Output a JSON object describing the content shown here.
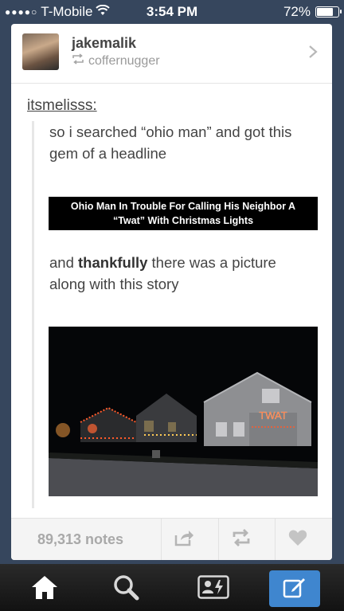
{
  "status_bar": {
    "carrier": "T-Mobile",
    "time": "3:54 PM",
    "battery": "72%",
    "battery_level": 0.72
  },
  "post": {
    "blog_name": "jakemalik",
    "reblogged_from": "coffernugger",
    "source_user": "itsmelisss:",
    "text_1": "so i searched “ohio man” and got this gem of a headline",
    "headline_line1": "Ohio Man In Trouble For Calling His Neighbor A",
    "headline_line2": "“Twat” With Christmas Lights",
    "text_2_before": "and ",
    "text_2_bold": "thankfully",
    "text_2_after": " there was a picture along with this story",
    "photo_lights_text": "TWAT",
    "notes": "89,313 notes"
  },
  "icons": {
    "header": [
      "chevron-right-icon",
      "reblog-icon"
    ],
    "footer": [
      "share-icon",
      "reblog-icon",
      "heart-icon"
    ],
    "tab_bar": [
      "home-icon",
      "search-icon",
      "account-activity-icon",
      "compose-icon"
    ]
  },
  "colors": {
    "background": "#36465d",
    "card": "#ffffff",
    "compose_button": "#3f86cf",
    "christmas_lights": "#ff5a2a"
  }
}
